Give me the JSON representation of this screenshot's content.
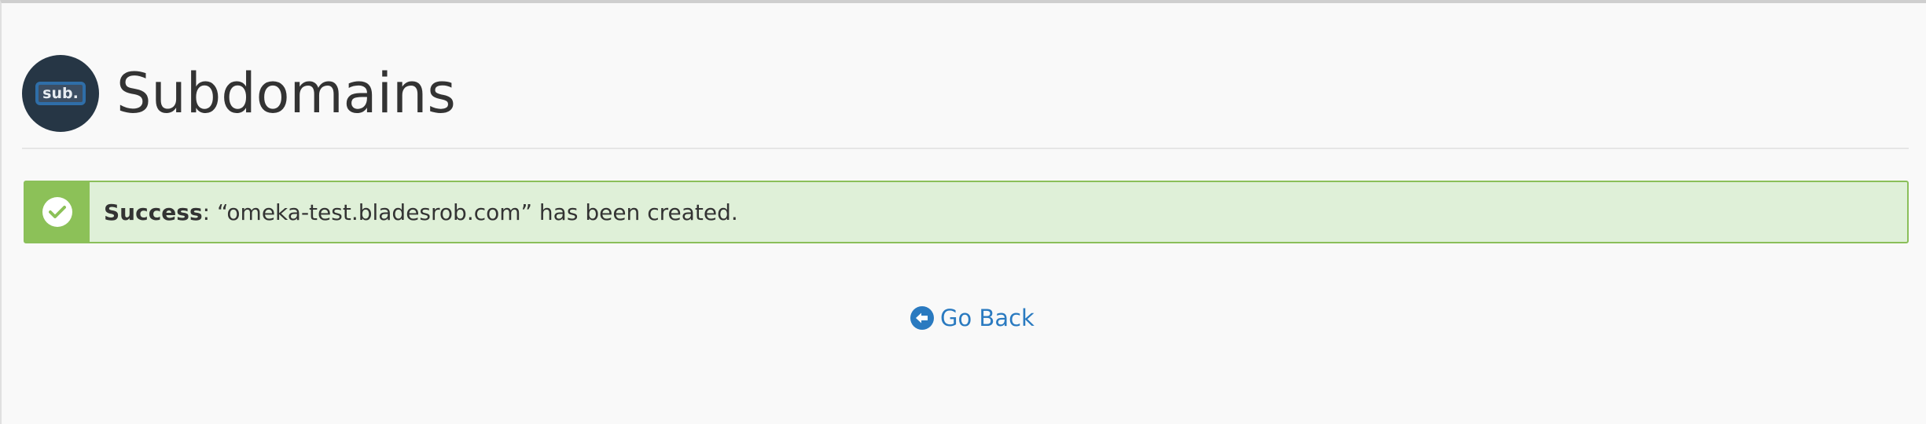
{
  "header": {
    "icon_label": "sub.",
    "title": "Subdomains"
  },
  "alert": {
    "icon": "check-circle-icon",
    "label": "Success",
    "message": ": “omeka-test.bladesrob.com” has been created."
  },
  "actions": {
    "go_back_icon": "arrow-circle-left-icon",
    "go_back_label": "Go Back"
  },
  "colors": {
    "background": "#f9f9f9",
    "success_fill": "#dff0d8",
    "success_accent": "#8cc158",
    "success_border": "#8bbf5a",
    "link": "#2a7ac0",
    "icon_dark": "#263645",
    "icon_blue": "#2f6ea8"
  }
}
